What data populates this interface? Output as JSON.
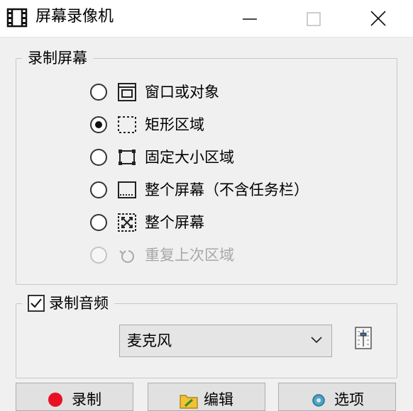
{
  "window": {
    "title": "屏幕录像机",
    "icons": {
      "app": "film-strip-icon",
      "minimize": "minimize-icon",
      "maximize": "maximize-icon",
      "close": "close-icon"
    }
  },
  "record_screen": {
    "legend": "录制屏幕",
    "selected_index": 1,
    "options": [
      {
        "label": "窗口或对象",
        "icon": "window-object-icon",
        "enabled": true
      },
      {
        "label": "矩形区域",
        "icon": "dashed-rectangle-icon",
        "enabled": true
      },
      {
        "label": "固定大小区域",
        "icon": "fixed-size-region-icon",
        "enabled": true
      },
      {
        "label": "整个屏幕（不含任务栏）",
        "icon": "screen-no-taskbar-icon",
        "enabled": true
      },
      {
        "label": "整个屏幕",
        "icon": "full-screen-icon",
        "enabled": true
      },
      {
        "label": "重复上次区域",
        "icon": "repeat-region-icon",
        "enabled": false
      }
    ]
  },
  "record_audio": {
    "legend": "录制音频",
    "checked": true,
    "source_value": "麦克风",
    "mixer_icon": "volume-mixer-icon"
  },
  "buttons": {
    "record": "录制",
    "edit": "编辑",
    "options": "选项"
  },
  "colors": {
    "record_dot": "#e81123",
    "accent_border": "#adadad"
  }
}
